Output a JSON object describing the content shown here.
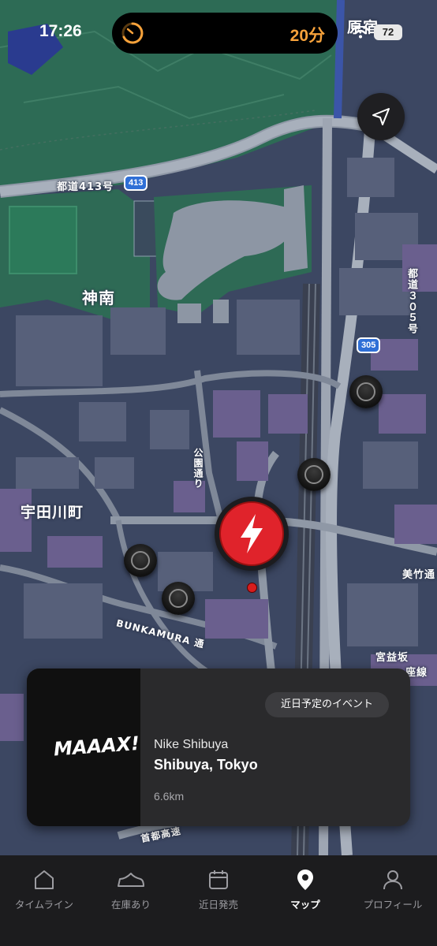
{
  "status": {
    "time": "17:26",
    "island_text": "20分",
    "battery": "72"
  },
  "map_labels": {
    "route413": "都道413号",
    "route413_shield": "413",
    "jinnan": "神南",
    "harajuku": "原宿",
    "route305": "都道３０５号",
    "route305_shield": "305",
    "koen_dori": "公園通り",
    "udagawa": "宇田川町",
    "bunkamura": "BUNKAMURA 通",
    "miyamasuzaka": "宮益坂",
    "meiji_dori": "美竹通り",
    "zakasen": "座線",
    "shuto_highway": "首都高速"
  },
  "card": {
    "badge": "近日予定のイベント",
    "thumb_logo": "MAAAX!!!",
    "store": "Nike Shibuya",
    "location": "Shibuya, Tokyo",
    "distance": "6.6km"
  },
  "tabs": [
    {
      "label": "タイムライン",
      "icon": "home-icon"
    },
    {
      "label": "在庫あり",
      "icon": "sneaker-icon"
    },
    {
      "label": "近日発売",
      "icon": "calendar-icon"
    },
    {
      "label": "マップ",
      "icon": "map-pin-icon",
      "active": true
    },
    {
      "label": "プロフィール",
      "icon": "person-icon"
    }
  ],
  "colors": {
    "accent": "#e0232b",
    "island_text": "#f7a23b",
    "tab_active": "#ffffff",
    "tab_inactive": "#9c9ca1"
  }
}
